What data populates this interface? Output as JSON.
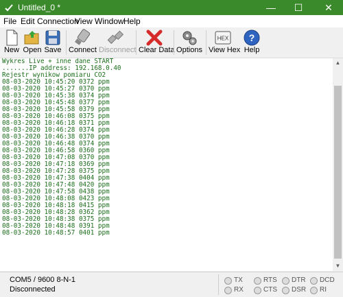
{
  "window": {
    "title": "Untitled_0 *",
    "controls": {
      "minimize": "—",
      "maximize": "☐",
      "close": "✕"
    }
  },
  "menu": [
    "File",
    "Edit",
    "Connection",
    "View",
    "Window",
    "Help"
  ],
  "toolbar": {
    "new": "New",
    "open": "Open",
    "save": "Save",
    "connect": "Connect",
    "disconnect": "Disconnect",
    "clear": "Clear Data",
    "options": "Options",
    "viewhex": "View Hex",
    "viewhex_icon_text": "HEX",
    "help": "Help",
    "help_icon_text": "?"
  },
  "terminal": {
    "lines": [
      "Wykres Live + inne dane START",
      ".......IP address: 192.168.0.40",
      "Rejestr wynikow pomiaru CO2",
      "08-03-2020 10:45:20 0372 ppm",
      "08-03-2020 10:45:27 0370 ppm",
      "08-03-2020 10:45:38 0374 ppm",
      "08-03-2020 10:45:48 0377 ppm",
      "08-03-2020 10:45:58 0379 ppm",
      "08-03-2020 10:46:08 0375 ppm",
      "08-03-2020 10:46:18 0371 ppm",
      "08-03-2020 10:46:28 0374 ppm",
      "08-03-2020 10:46:38 0370 ppm",
      "08-03-2020 10:46:48 0374 ppm",
      "08-03-2020 10:46:58 0360 ppm",
      "08-03-2020 10:47:08 0370 ppm",
      "08-03-2020 10:47:18 0369 ppm",
      "08-03-2020 10:47:28 0375 ppm",
      "08-03-2020 10:47:38 0404 ppm",
      "08-03-2020 10:47:48 0420 ppm",
      "08-03-2020 10:47:58 0438 ppm",
      "08-03-2020 10:48:08 0423 ppm",
      "08-03-2020 10:48:18 0415 ppm",
      "08-03-2020 10:48:28 0362 ppm",
      "08-03-2020 10:48:38 0375 ppm",
      "08-03-2020 10:48:48 0391 ppm",
      "08-03-2020 10:48:57 0401 ppm"
    ]
  },
  "status": {
    "port": "COM5 / 9600 8-N-1",
    "state": "Disconnected",
    "signals": [
      "TX",
      "RX",
      "RTS",
      "CTS",
      "DTR",
      "DSR",
      "DCD",
      "RI"
    ]
  },
  "colors": {
    "titlebar": "#3a8a2b",
    "terminal_text": "#1b6e1b"
  }
}
